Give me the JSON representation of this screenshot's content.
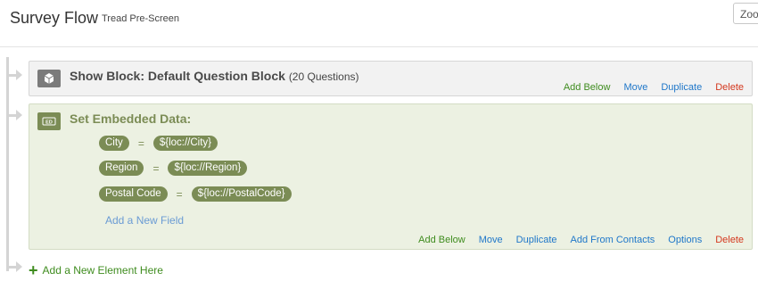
{
  "header": {
    "title": "Survey Flow",
    "subtitle": "Tread Pre-Screen",
    "zoom_label": "Zoom"
  },
  "blocks": {
    "show": {
      "title": "Show Block: Default Question Block",
      "count": "(20 Questions)",
      "icon": "cube-icon",
      "actions": {
        "add_below": "Add Below",
        "move": "Move",
        "duplicate": "Duplicate",
        "delete": "Delete"
      }
    },
    "embedded": {
      "title": "Set Embedded Data:",
      "icon": "embedded-data-icon",
      "icon_text": "ED",
      "fields": [
        {
          "name": "City",
          "operator": "=",
          "value": "${loc://City}"
        },
        {
          "name": "Region",
          "operator": "=",
          "value": "${loc://Region}"
        },
        {
          "name": "Postal Code",
          "operator": "=",
          "value": "${loc://PostalCode}"
        }
      ],
      "add_field": "Add a New Field",
      "actions": {
        "add_below": "Add Below",
        "move": "Move",
        "duplicate": "Duplicate",
        "add_from_contacts": "Add From Contacts",
        "options": "Options",
        "delete": "Delete"
      }
    }
  },
  "add_element": "Add a New Element Here",
  "colors": {
    "action_green": "#3f8c1f",
    "action_blue": "#1f77c9",
    "action_red": "#d4381e",
    "embedded_accent": "#7b8c55",
    "embedded_bg": "#ecf1e2"
  }
}
